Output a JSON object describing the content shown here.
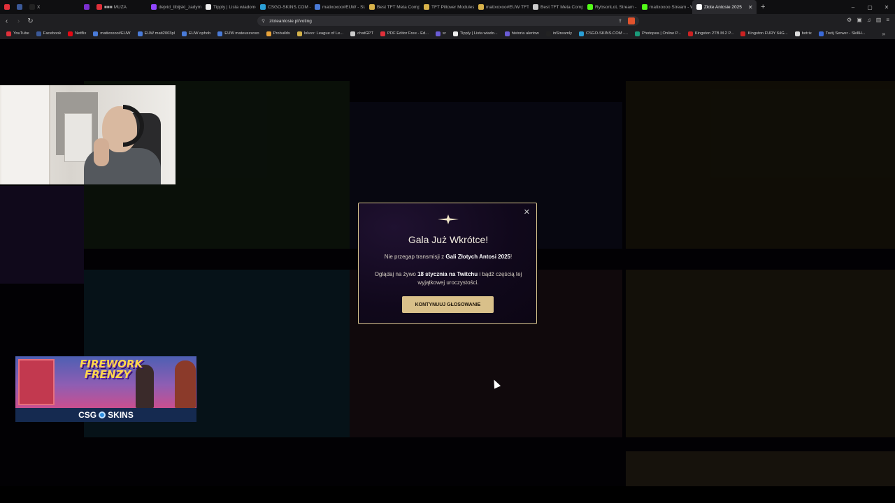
{
  "browser": {
    "tabs": [
      {
        "label": "",
        "color": "#e0303a"
      },
      {
        "label": "",
        "color": "#3b5998"
      },
      {
        "label": "X",
        "color": "#222"
      },
      {
        "label": "",
        "color": "#7b2fd0"
      },
      {
        "label": "■■■ MUZA",
        "color": "#e0303a"
      },
      {
        "label": "dejvid_tibijski_zadymiar",
        "color": "#9146ff"
      },
      {
        "label": "Tipply | Lista wiadomości",
        "color": "#eee"
      },
      {
        "label": "CSGO-SKINS.COM - Najl",
        "color": "#2a9fd6"
      },
      {
        "label": "matixoxoo#EUW - Statys",
        "color": "#4a7bd8"
      },
      {
        "label": "Best TFT Meta Comps &",
        "color": "#d8b24a"
      },
      {
        "label": "TFT Piltover Modules Tie",
        "color": "#d8b24a"
      },
      {
        "label": "matixoxoo#EUW TFT M",
        "color": "#d8b24a"
      },
      {
        "label": "Best TFT Meta Comps fo",
        "color": "#cccccc"
      },
      {
        "label": "RybsonLoL Stream - Win",
        "color": "#53fc18"
      },
      {
        "label": "matixoxoo Stream - Win",
        "color": "#53fc18"
      },
      {
        "label": "Złote Antosie 2025",
        "color": "#ffffff",
        "active": true
      }
    ],
    "new_tab": "+",
    "address": "zloteantosie.pl/voting",
    "bookmarks": [
      {
        "label": "YouTube",
        "color": "#e0303a"
      },
      {
        "label": "Facebook",
        "color": "#3b5998"
      },
      {
        "label": "Netflix",
        "color": "#e50914"
      },
      {
        "label": "matixoxoo#EUW",
        "color": "#4a7bd8"
      },
      {
        "label": "EUW mati2003pl",
        "color": "#4a7bd8"
      },
      {
        "label": "EUW ophob",
        "color": "#4a7bd8"
      },
      {
        "label": "EUW mateuszxoxo",
        "color": "#4a7bd8"
      },
      {
        "label": "Probuilds",
        "color": "#e8a33a"
      },
      {
        "label": "lolvvv: League of Le...",
        "color": "#d4b24a"
      },
      {
        "label": "chatGPT",
        "color": "#cccccc"
      },
      {
        "label": "PDF Editor Free - Ed...",
        "color": "#e0303a"
      },
      {
        "label": "sr",
        "color": "#6a5cd6"
      },
      {
        "label": "Tipply | Lista wiado...",
        "color": "#eeeeee"
      },
      {
        "label": "historia alertow",
        "color": "#6a5cd6"
      },
      {
        "label": "inStreamly",
        "color": "#222222"
      },
      {
        "label": "CSGO-SKINS.COM -...",
        "color": "#2a9fd6"
      },
      {
        "label": "Photopea | Online P...",
        "color": "#1a9b7a"
      },
      {
        "label": "Kingston 2TB M.2 P...",
        "color": "#cc2222"
      },
      {
        "label": "Kingston FURY 64G...",
        "color": "#cc2222"
      },
      {
        "label": "botrix",
        "color": "#dddddd"
      },
      {
        "label": "Twój Serwer - SkillH...",
        "color": "#3a6ad8"
      }
    ],
    "bookmarks_more": "»"
  },
  "icons": {
    "back": "‹",
    "forward": "›",
    "reload": "↻",
    "close": "✕",
    "minimize": "–",
    "maximize": "▢",
    "lock": "⚲",
    "share": "⇪",
    "menu": "≡"
  },
  "modal": {
    "title": "Gala Już Wkrótce!",
    "line1_prefix": "Nie przegap transmisji z ",
    "line1_bold": "Gali Złotych Antosi 2025",
    "line1_suffix": "!",
    "line2_prefix": "Oglądaj na żywo ",
    "line2_bold": "18 stycznia na Twitchu",
    "line2_suffix": " i bądź częścią tej wyjątkowej uroczystości.",
    "button": "KONTYNUUJ GŁOSOWANIE",
    "accent": "#d9c08a"
  },
  "sponsor_banner": {
    "title_line1": "FIREWORK",
    "title_line2": "FRENZY",
    "brand_left": "CSG",
    "brand_right": "SKINS"
  }
}
